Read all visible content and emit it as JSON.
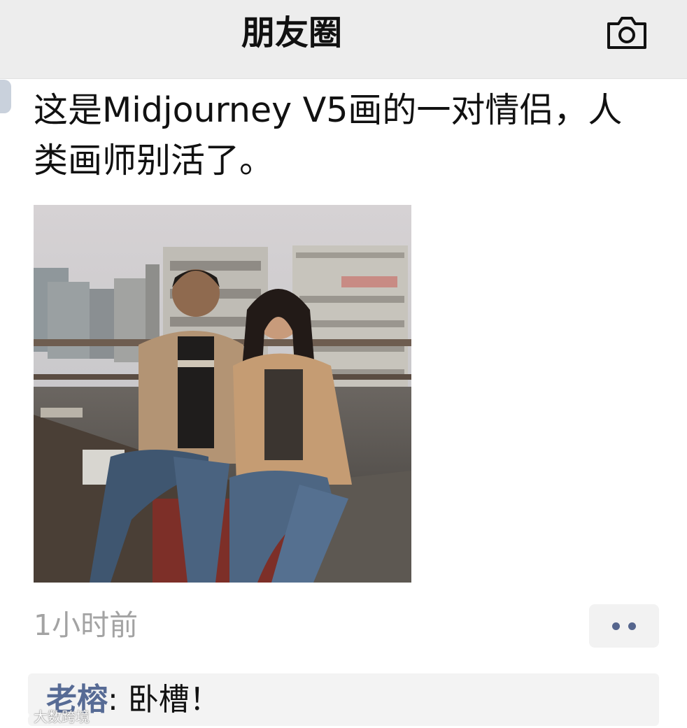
{
  "header": {
    "title": "朋友圈"
  },
  "post": {
    "text": "这是Midjourney V5画的一对情侣，人类画师别活了。",
    "image_icon": "ai-couple-rooftop-photo",
    "timestamp": "1小时前"
  },
  "actions": {
    "more_icon": "more-dots-icon"
  },
  "comments": [
    {
      "author": "老榕",
      "separator": ": ",
      "text": "卧槽！"
    }
  ],
  "watermark": {
    "text": "大数跨境"
  },
  "colors": {
    "header_bg": "#ededed",
    "link_blue": "#576b95",
    "timestamp_gray": "#a3a3a3",
    "comment_bg": "#f3f3f3"
  }
}
